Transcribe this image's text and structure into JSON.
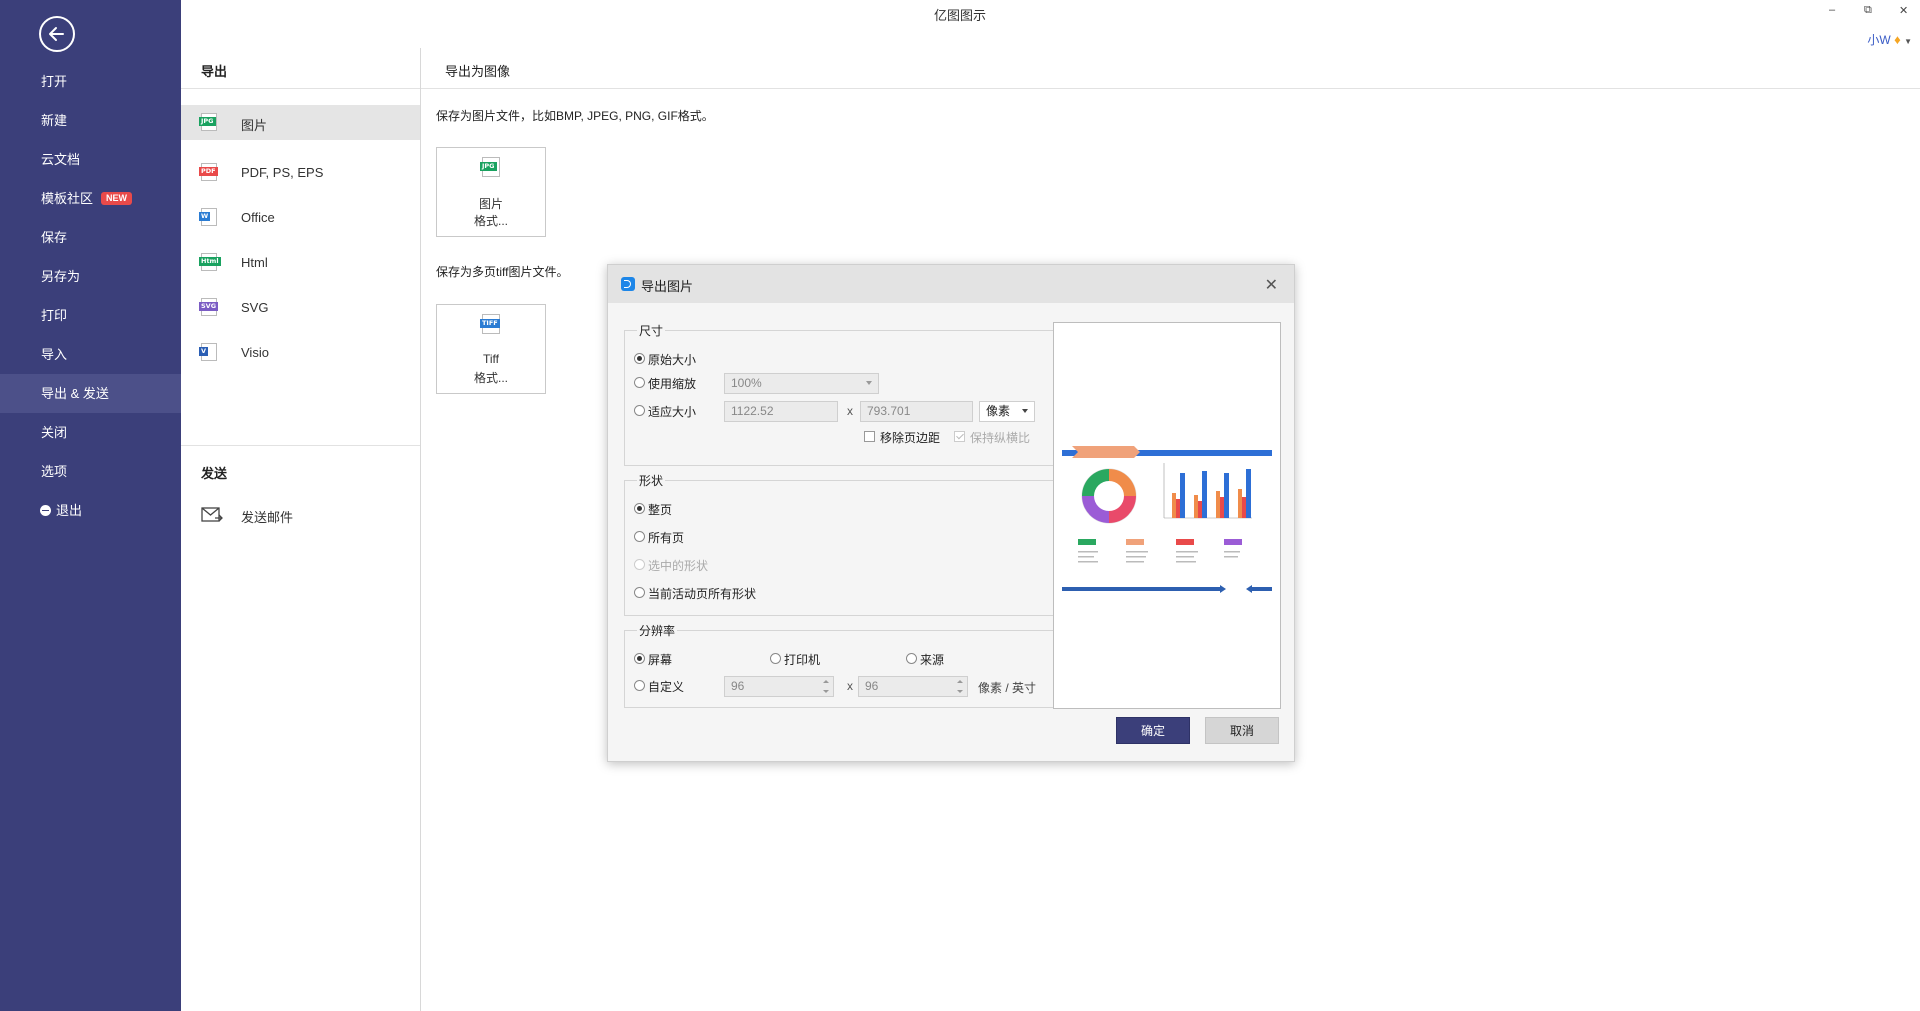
{
  "app": {
    "title": "亿图图示"
  },
  "window_controls": {
    "minimize": "–",
    "restore": "⧉",
    "close": "✕"
  },
  "user": {
    "name": "小W",
    "badge_icon": "diamond-icon"
  },
  "sidebar": {
    "back_icon": "arrow-left-icon",
    "items": [
      {
        "label": "打开"
      },
      {
        "label": "新建"
      },
      {
        "label": "云文档"
      },
      {
        "label": "模板社区",
        "badge": "NEW"
      },
      {
        "label": "保存"
      },
      {
        "label": "另存为"
      },
      {
        "label": "打印"
      },
      {
        "label": "导入"
      },
      {
        "label": "导出 & 发送",
        "active": true
      },
      {
        "label": "关闭"
      },
      {
        "label": "选项"
      },
      {
        "label": "退出",
        "icon": "exit-icon"
      }
    ]
  },
  "export_panel": {
    "heading": "导出",
    "items": [
      {
        "label": "图片",
        "tag": "JPG",
        "color": "#1aa260",
        "active": true
      },
      {
        "label": "PDF, PS, EPS",
        "tag": "PDF",
        "color": "#e94a4a"
      },
      {
        "label": "Office",
        "tag": "W",
        "color": "#2b7cd3"
      },
      {
        "label": "Html",
        "tag": "Html",
        "color": "#1aa260"
      },
      {
        "label": "SVG",
        "tag": "SVG",
        "color": "#7b5cc4"
      },
      {
        "label": "Visio",
        "tag": "V",
        "color": "#2b5fb5"
      }
    ],
    "send_heading": "发送",
    "send_item": {
      "label": "发送邮件",
      "icon": "mail-send-icon"
    }
  },
  "content": {
    "heading": "导出为图像",
    "desc1": "保存为图片文件，比如BMP, JPEG, PNG, GIF格式。",
    "image_btn": {
      "tag": "JPG",
      "line1": "图片",
      "line2": "格式..."
    },
    "desc2": "保存为多页tiff图片文件。",
    "tiff_btn": {
      "tag": "TIFF",
      "line1": "Tiff",
      "line2": "格式..."
    }
  },
  "dialog": {
    "title": "导出图片",
    "close_icon": "close-icon",
    "size": {
      "title": "尺寸",
      "original": "原始大小",
      "scale": "使用缩放",
      "scale_value": "100%",
      "fit": "适应大小",
      "width": "1122.52",
      "x": "x",
      "height": "793.701",
      "unit": "像素",
      "remove_margin": "移除页边距",
      "keep_ratio": "保持纵横比"
    },
    "shape": {
      "title": "形状",
      "whole_page": "整页",
      "all_pages": "所有页",
      "selected": "选中的形状",
      "all_on_page": "当前活动页所有形状"
    },
    "resolution": {
      "title": "分辨率",
      "screen": "屏幕",
      "printer": "打印机",
      "source": "来源",
      "custom": "自定义",
      "dpi_x": "96",
      "x": "x",
      "dpi_y": "96",
      "unit": "像素 / 英寸"
    },
    "ok": "确定",
    "cancel": "取消"
  }
}
